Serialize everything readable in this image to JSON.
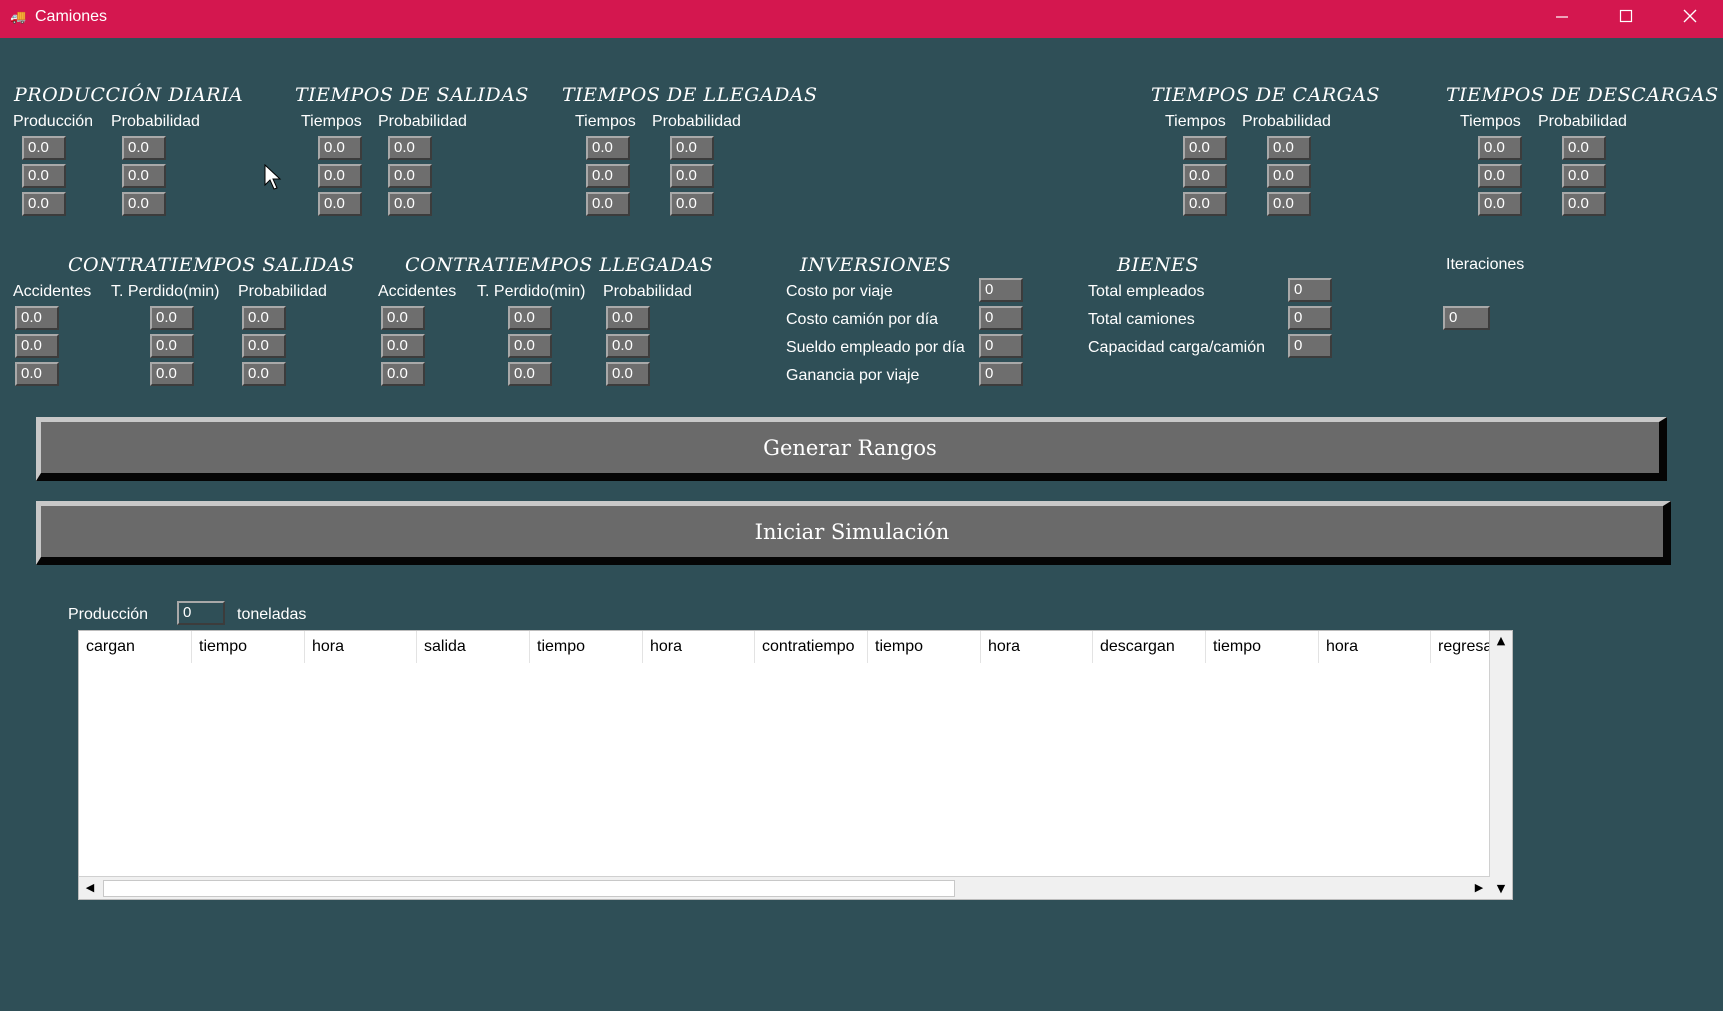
{
  "window": {
    "title": "Camiones",
    "icon": "truck-app-icon"
  },
  "produccion_diaria": {
    "title": "PRODUCCIÓN DIARIA",
    "col1": "Producción",
    "col2": "Probabilidad",
    "values": [
      "0.0",
      "0.0",
      "0.0",
      "0.0",
      "0.0",
      "0.0"
    ]
  },
  "tiempos_salidas": {
    "title": "TIEMPOS DE SALIDAS",
    "col1": "Tiempos",
    "col2": "Probabilidad",
    "values": [
      "0.0",
      "0.0",
      "0.0",
      "0.0",
      "0.0",
      "0.0"
    ]
  },
  "tiempos_llegadas": {
    "title": "TIEMPOS DE LLEGADAS",
    "col1": "Tiempos",
    "col2": "Probabilidad",
    "values": [
      "0.0",
      "0.0",
      "0.0",
      "0.0",
      "0.0",
      "0.0"
    ]
  },
  "tiempos_cargas": {
    "title": "TIEMPOS DE CARGAS",
    "col1": "Tiempos",
    "col2": "Probabilidad",
    "values": [
      "0.0",
      "0.0",
      "0.0",
      "0.0",
      "0.0",
      "0.0"
    ]
  },
  "tiempos_descargas": {
    "title": "TIEMPOS DE DESCARGAS",
    "col1": "Tiempos",
    "col2": "Probabilidad",
    "values": [
      "0.0",
      "0.0",
      "0.0",
      "0.0",
      "0.0",
      "0.0"
    ]
  },
  "contratiempos_salidas": {
    "title": "CONTRATIEMPOS SALIDAS",
    "col1": "Accidentes",
    "col2": "T. Perdido(min)",
    "col3": "Probabilidad",
    "values": [
      "0.0",
      "0.0",
      "0.0",
      "0.0",
      "0.0",
      "0.0",
      "0.0",
      "0.0",
      "0.0"
    ]
  },
  "contratiempos_llegadas": {
    "title": "CONTRATIEMPOS LLEGADAS",
    "col1": "Accidentes",
    "col2": "T. Perdido(min)",
    "col3": "Probabilidad",
    "values": [
      "0.0",
      "0.0",
      "0.0",
      "0.0",
      "0.0",
      "0.0",
      "0.0",
      "0.0",
      "0.0"
    ]
  },
  "inversiones": {
    "title": "INVERSIONES",
    "rows": [
      {
        "label": "Costo por viaje",
        "value": "0"
      },
      {
        "label": "Costo camión por día",
        "value": "0"
      },
      {
        "label": "Sueldo empleado por día",
        "value": "0"
      },
      {
        "label": "Ganancia por viaje",
        "value": "0"
      }
    ]
  },
  "bienes": {
    "title": "BIENES",
    "rows": [
      {
        "label": "Total empleados",
        "value": "0"
      },
      {
        "label": "Total camiones",
        "value": "0"
      },
      {
        "label": "Capacidad carga/camión",
        "value": "0"
      }
    ]
  },
  "iteraciones": {
    "label": "Iteraciones",
    "value": "0"
  },
  "buttons": {
    "generar": "Generar Rangos",
    "iniciar": "Iniciar Simulación"
  },
  "produccion_result": {
    "label": "Producción",
    "value": "0",
    "unit": "toneladas"
  },
  "table": {
    "columns": [
      "cargan",
      "tiempo",
      "hora",
      "salida",
      "tiempo",
      "hora",
      "contratiempo",
      "tiempo",
      "hora",
      "descargan",
      "tiempo",
      "hora",
      "regresa"
    ],
    "rows": []
  },
  "colors": {
    "titlebar": "#d4174f",
    "background": "#2f4f57",
    "field": "#6e6e6e",
    "button": "#6a6a6a"
  }
}
